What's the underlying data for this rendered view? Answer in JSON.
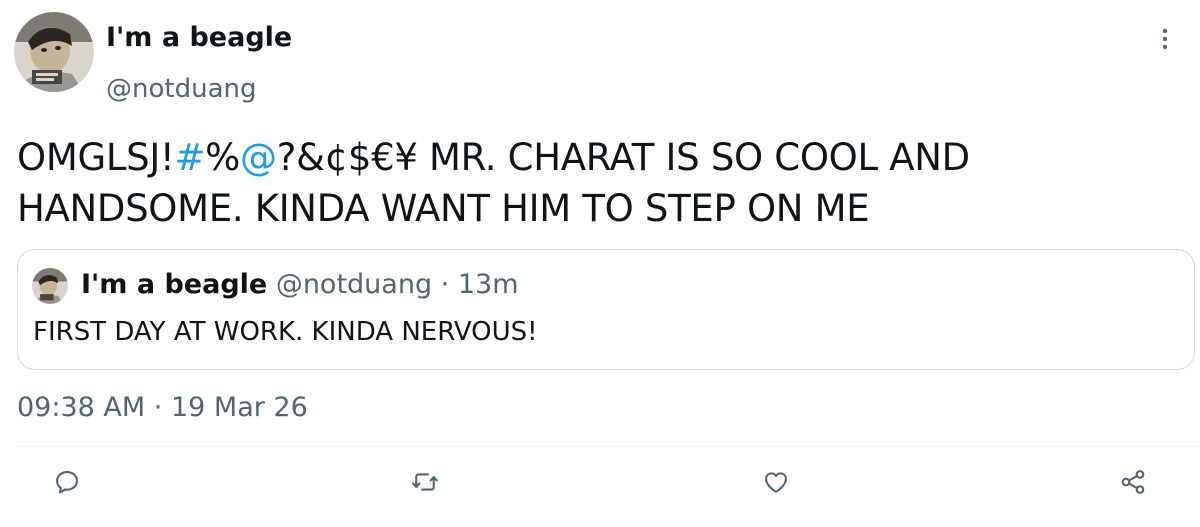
{
  "author": {
    "display_name": "I'm a beagle",
    "handle": "@notduang"
  },
  "tweet": {
    "text_prefix": "OMGLSJ!",
    "text_blue_1": "#",
    "text_mid": "%",
    "text_blue_2": "@",
    "text_suffix": "?&¢$€¥ MR. CHARAT IS SO COOL AND HANDSOME. KINDA WANT HIM TO STEP ON ME"
  },
  "quoted_tweet": {
    "display_name": "I'm a beagle",
    "handle": "@notduang",
    "separator": "·",
    "age": "13m",
    "text": "FIRST DAY AT WORK. KINDA NERVOUS!"
  },
  "timestamp": {
    "time": "09:38 AM",
    "separator": "·",
    "date": "19 Mar 26"
  },
  "actions": [
    {
      "icon": "reply-icon"
    },
    {
      "icon": "retweet-icon"
    },
    {
      "icon": "like-icon"
    },
    {
      "icon": "share-icon"
    }
  ],
  "colors": {
    "text_primary": "#0f1419",
    "text_secondary": "#536471",
    "accent": "#1d9bf0",
    "border": "#cfd9de"
  }
}
